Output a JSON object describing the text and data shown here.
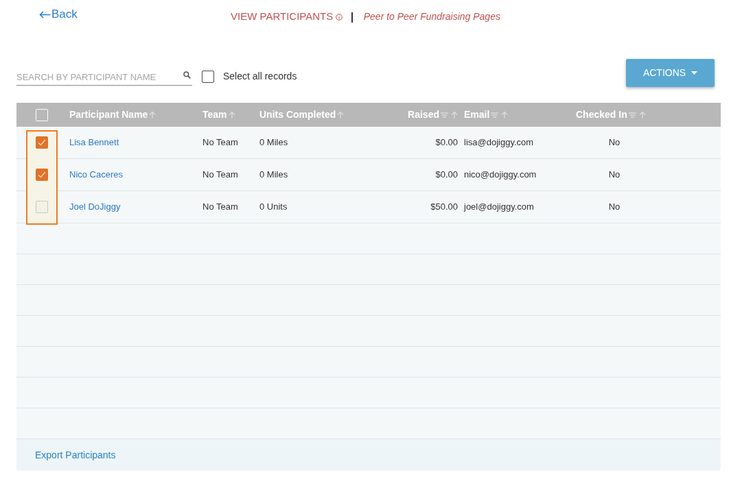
{
  "header": {
    "back": "Back",
    "title": "VIEW PARTICIPANTS",
    "subtitle": "Peer to Peer Fundraising Pages"
  },
  "toolbar": {
    "search": {
      "placeholder": "SEARCH BY PARTICIPANT NAME"
    },
    "select_all": {
      "label": "Select all records",
      "checked": false
    },
    "actions": "ACTIONS"
  },
  "table": {
    "header_checkbox": {
      "checked": false
    },
    "highlight_selection_column": true,
    "columns": [
      {
        "label": "Participant Name",
        "filter": false
      },
      {
        "label": "Team",
        "filter": false
      },
      {
        "label": "Units Completed",
        "filter": false
      },
      {
        "label": "Raised",
        "filter": true
      },
      {
        "label": "Email",
        "filter": true
      },
      {
        "label": "Checked In",
        "filter": true
      }
    ],
    "rows": [
      {
        "checked": true,
        "cells": [
          "Lisa Bennett",
          "No Team",
          "0 Miles",
          "$0.00",
          "lisa@dojiggy.com",
          "No"
        ]
      },
      {
        "checked": true,
        "cells": [
          "Nico Caceres",
          "No Team",
          "0 Miles",
          "$0.00",
          "nico@dojiggy.com",
          "No"
        ]
      },
      {
        "checked": false,
        "cells": [
          "Joel DoJiggy",
          "No Team",
          "0 Units",
          "$50.00",
          "joel@dojiggy.com",
          "No"
        ]
      }
    ]
  },
  "footer": {
    "link": "Export Participants"
  }
}
